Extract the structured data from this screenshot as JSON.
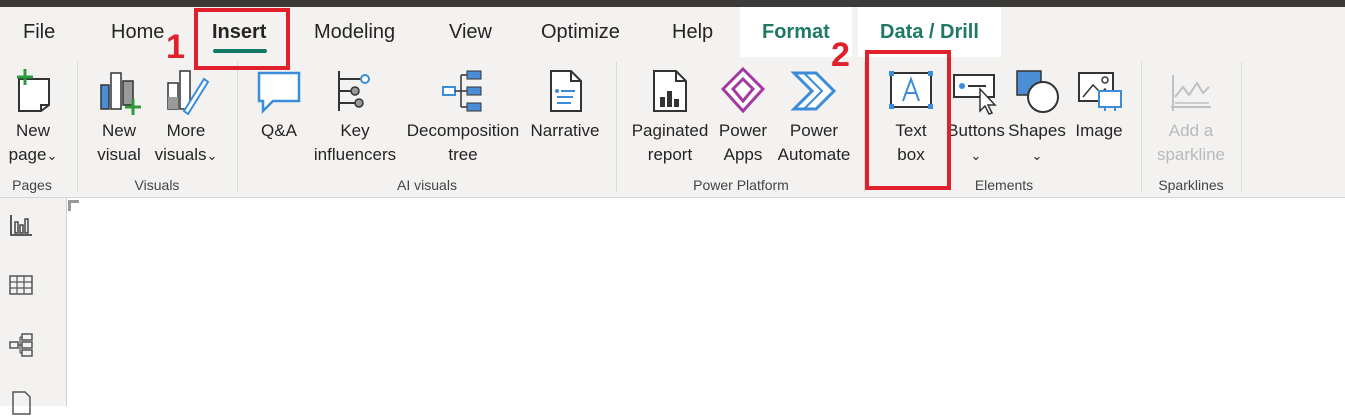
{
  "tabs": [
    {
      "label": "File"
    },
    {
      "label": "Home"
    },
    {
      "label": "Insert"
    },
    {
      "label": "Modeling"
    },
    {
      "label": "View"
    },
    {
      "label": "Optimize"
    },
    {
      "label": "Help"
    },
    {
      "label": "Format"
    },
    {
      "label": "Data / Drill"
    }
  ],
  "groups": {
    "pages": "Pages",
    "visuals": "Visuals",
    "ai_visuals": "AI visuals",
    "power_platform": "Power Platform",
    "elements": "Elements",
    "sparklines": "Sparklines"
  },
  "buttons": {
    "new_page": {
      "l1": "New",
      "l2": "page",
      "chev": "⌄"
    },
    "new_visual": {
      "l1": "New",
      "l2": "visual"
    },
    "more_visuals": {
      "l1": "More",
      "l2": "visuals",
      "chev": "⌄"
    },
    "qa": {
      "l1": "Q&A"
    },
    "key_influencers": {
      "l1": "Key",
      "l2": "influencers"
    },
    "decomposition_tree": {
      "l1": "Decomposition",
      "l2": "tree"
    },
    "narrative": {
      "l1": "Narrative"
    },
    "paginated_report": {
      "l1": "Paginated",
      "l2": "report"
    },
    "power_apps": {
      "l1": "Power",
      "l2": "Apps"
    },
    "power_automate": {
      "l1": "Power",
      "l2": "Automate"
    },
    "text_box": {
      "l1": "Text",
      "l2": "box"
    },
    "buttons": {
      "l1": "Buttons",
      "chev": "⌄"
    },
    "shapes": {
      "l1": "Shapes",
      "chev": "⌄"
    },
    "image": {
      "l1": "Image"
    },
    "add_sparkline": {
      "l1": "Add a",
      "l2": "sparkline"
    }
  },
  "annotations": {
    "marker1": "1",
    "marker2": "2"
  },
  "colors": {
    "accent": "#117865",
    "annotation": "#e0202a",
    "context_tab": "#1e7a63",
    "icon_blue": "#3c8dd9"
  }
}
